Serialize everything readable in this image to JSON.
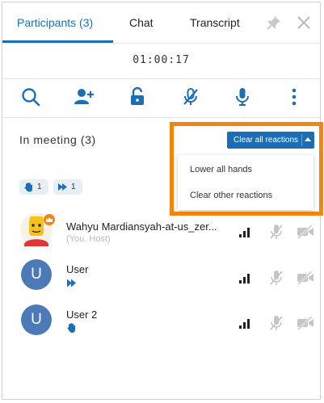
{
  "tabs": {
    "participants": "Participants (3)",
    "chat": "Chat",
    "transcript": "Transcript"
  },
  "timer": "01:00:17",
  "toolbar": [
    "search-icon",
    "add-user-icon",
    "unlock-icon",
    "mute-all-icon",
    "mic-icon",
    "more-icon"
  ],
  "meeting": {
    "title": "In meeting (3)",
    "clear_button": "Clear all reactions",
    "menu": {
      "lower_hands": "Lower all hands",
      "clear_other": "Clear other reactions"
    }
  },
  "reactions": {
    "hands_count": "1",
    "speed_up_count": "1"
  },
  "participants": [
    {
      "name": "Wahyu Mardiansyah-at-us_zer...",
      "subtitle": "(You, Host)",
      "avatar": "emoji-avatar"
    },
    {
      "name": "User",
      "avatar_letter": "U",
      "reaction": "speed-up-icon"
    },
    {
      "name": "User 2",
      "avatar_letter": "U",
      "reaction": "raised-hand-icon"
    }
  ],
  "colors": {
    "accent": "#1a6fb5",
    "highlight": "#f5840c",
    "avatar": "#4c7ab8",
    "reaction_chip": "#e8eef6"
  }
}
